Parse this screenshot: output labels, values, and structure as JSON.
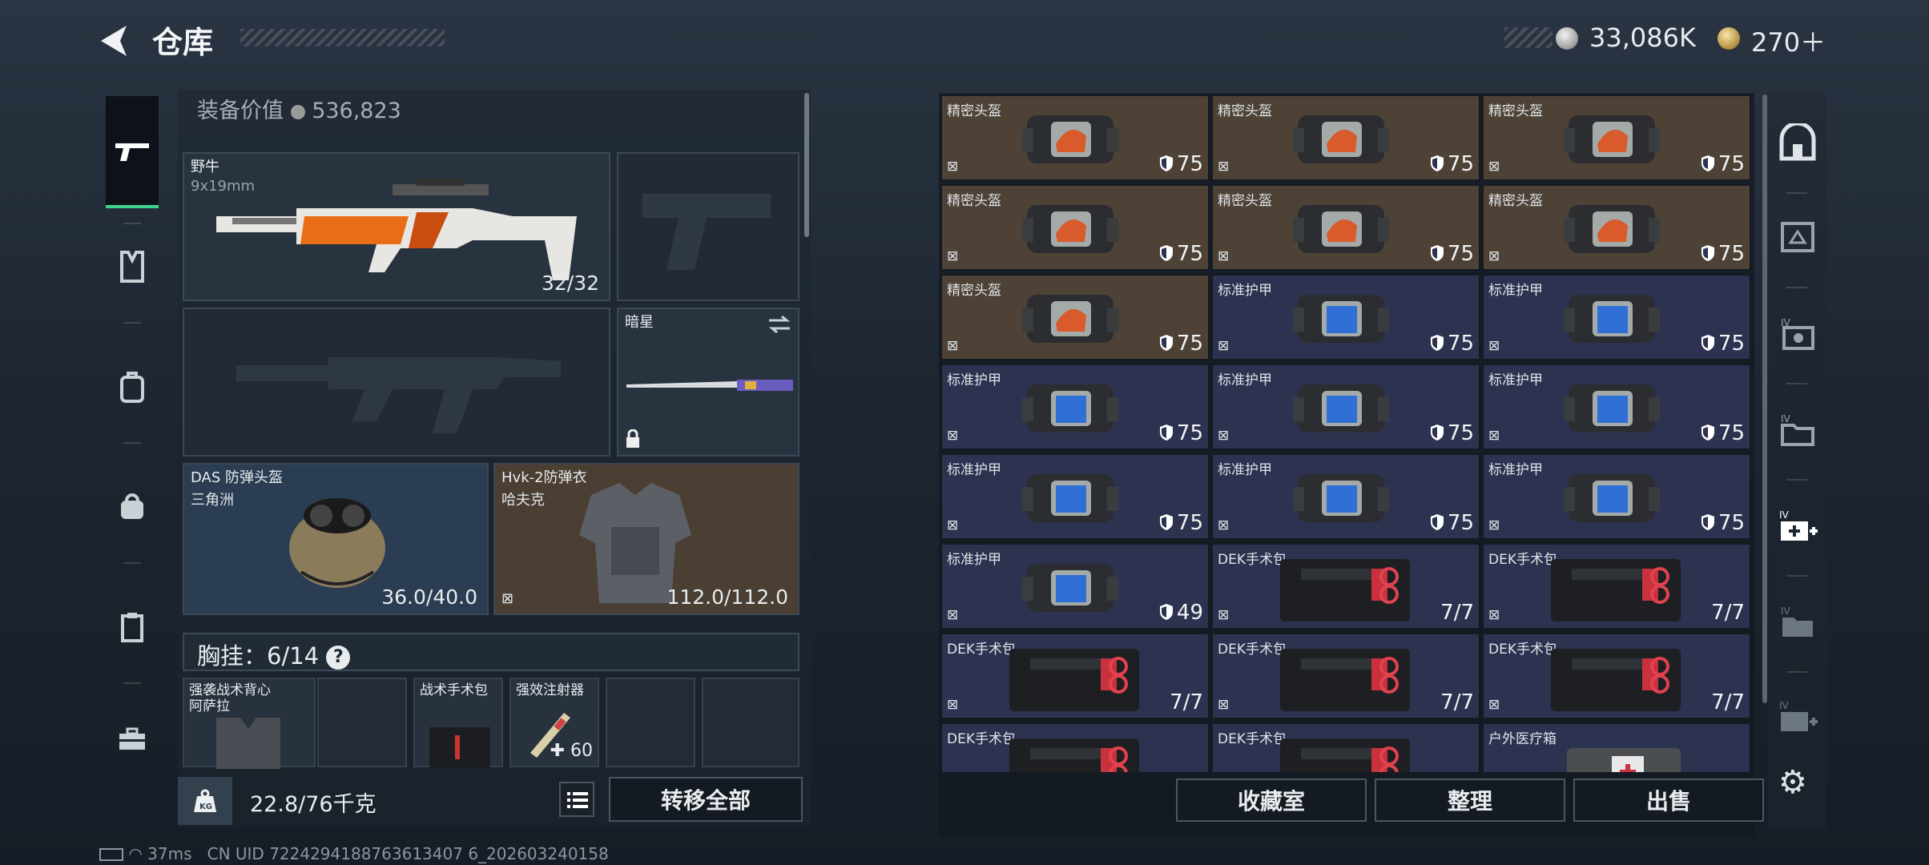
{
  "header": {
    "title": "仓库",
    "coin_silver": "33,086K",
    "coin_gold": "270＋"
  },
  "equipment": {
    "value_label": "装备价值",
    "value": "536,823",
    "primary": {
      "name": "野牛",
      "ammo": "9x19mm",
      "count": "32/32"
    },
    "melee": {
      "name": "暗星"
    },
    "helmet": {
      "name": "DAS 防弹头盔",
      "faction": "三角洲",
      "durability": "36.0/40.0"
    },
    "armor": {
      "name": "Hvk-2防弹衣",
      "faction": "哈夫克",
      "durability": "112.0/112.0"
    }
  },
  "chest": {
    "label": "胸挂：6/14",
    "help": "?",
    "slots": [
      {
        "name": "强袭战术背心",
        "sub": "阿萨拉"
      },
      {
        "name": "战术手术包"
      },
      {
        "name": "强效注射器",
        "qty": "60"
      }
    ]
  },
  "bottom": {
    "weight": "22.8/76千克",
    "transfer_all": "转移全部"
  },
  "storage": {
    "items": [
      {
        "name": "精密头盔",
        "qty": "75",
        "kind": "helmet"
      },
      {
        "name": "精密头盔",
        "qty": "75",
        "kind": "helmet"
      },
      {
        "name": "精密头盔",
        "qty": "75",
        "kind": "helmet"
      },
      {
        "name": "精密头盔",
        "qty": "75",
        "kind": "helmet"
      },
      {
        "name": "精密头盔",
        "qty": "75",
        "kind": "helmet"
      },
      {
        "name": "精密头盔",
        "qty": "75",
        "kind": "helmet"
      },
      {
        "name": "精密头盔",
        "qty": "75",
        "kind": "helmet"
      },
      {
        "name": "标准护甲",
        "qty": "75",
        "kind": "armor"
      },
      {
        "name": "标准护甲",
        "qty": "75",
        "kind": "armor"
      },
      {
        "name": "标准护甲",
        "qty": "75",
        "kind": "armor"
      },
      {
        "name": "标准护甲",
        "qty": "75",
        "kind": "armor"
      },
      {
        "name": "标准护甲",
        "qty": "75",
        "kind": "armor"
      },
      {
        "name": "标准护甲",
        "qty": "75",
        "kind": "armor"
      },
      {
        "name": "标准护甲",
        "qty": "75",
        "kind": "armor"
      },
      {
        "name": "标准护甲",
        "qty": "75",
        "kind": "armor"
      },
      {
        "name": "标准护甲",
        "qty": "49",
        "kind": "armor"
      },
      {
        "name": "DEK手术包",
        "qty": "7/7",
        "kind": "medkit"
      },
      {
        "name": "DEK手术包",
        "qty": "7/7",
        "kind": "medkit"
      },
      {
        "name": "DEK手术包",
        "qty": "7/7",
        "kind": "medkit"
      },
      {
        "name": "DEK手术包",
        "qty": "7/7",
        "kind": "medkit"
      },
      {
        "name": "DEK手术包",
        "qty": "7/7",
        "kind": "medkit"
      },
      {
        "name": "DEK手术包",
        "qty": "",
        "kind": "medkit"
      },
      {
        "name": "DEK手术包",
        "qty": "",
        "kind": "medkit"
      },
      {
        "name": "户外医疗箱",
        "qty": "",
        "kind": "medbox"
      }
    ],
    "buttons": {
      "collection": "收藏室",
      "organize": "整理",
      "sell": "出售"
    }
  },
  "status": {
    "ping": "37ms",
    "uid": "CN UID 7224294188763613407 6_202603240158"
  },
  "colors": {
    "accent_green": "#3fd28a",
    "helmet_bg": "#4e4236",
    "armor_bg": "#2c3250"
  }
}
